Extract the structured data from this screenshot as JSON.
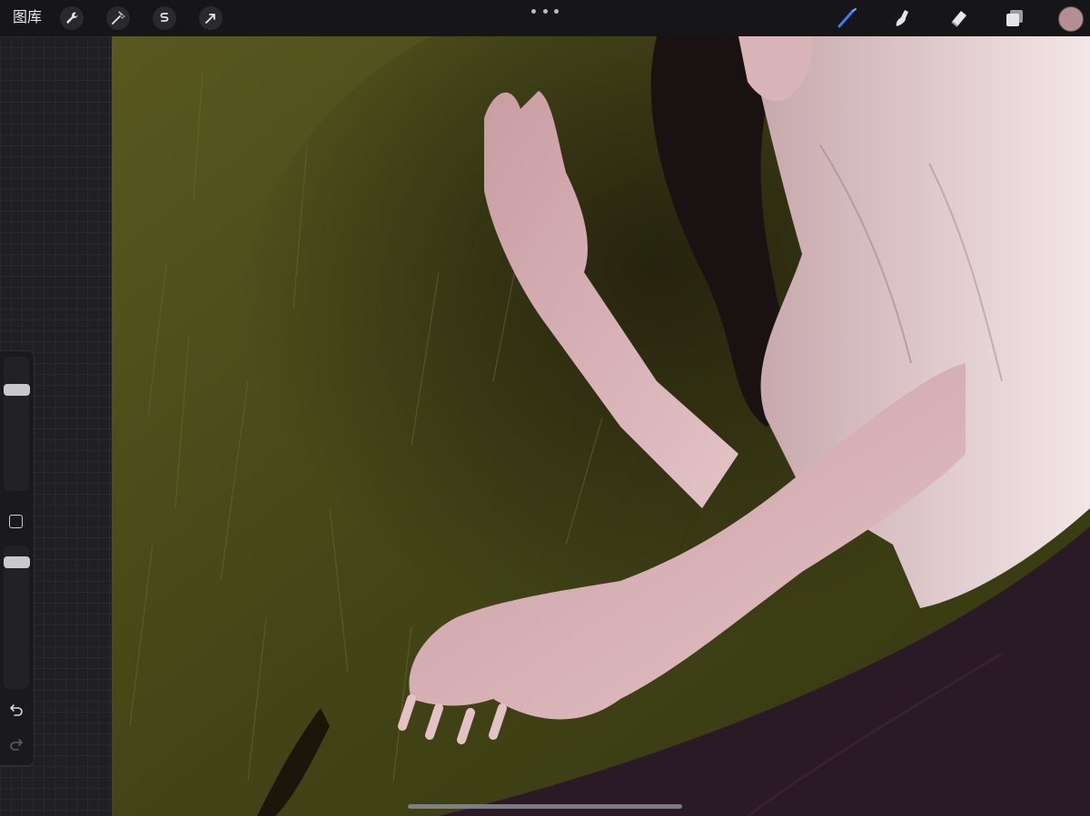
{
  "toolbar": {
    "gallery_label": "图库",
    "left_tools": [
      {
        "icon": "wrench-icon",
        "name": "actions"
      },
      {
        "icon": "magic-wand-icon",
        "name": "adjustments"
      },
      {
        "icon": "selection-s-icon",
        "name": "selection"
      },
      {
        "icon": "arrow-cursor-icon",
        "name": "transform"
      }
    ],
    "right_tools": [
      {
        "icon": "brush-icon",
        "name": "paint",
        "active": true
      },
      {
        "icon": "smudge-icon",
        "name": "smudge"
      },
      {
        "icon": "eraser-icon",
        "name": "eraser"
      },
      {
        "icon": "layers-icon",
        "name": "layers"
      }
    ],
    "current_color": "#b58e95",
    "active_tool_color": "#3a7bff"
  },
  "sidebar": {
    "brush_size_level": 0.78,
    "opacity_level": 0.92,
    "icons": [
      "modify-square-icon",
      "undo-icon",
      "redo-icon"
    ]
  },
  "canvas": {
    "palette": {
      "grass_dark": "#3f4318",
      "grass_mid": "#5a5a22",
      "shadow": "#2a2810",
      "skin": "#d9b4b8",
      "shirt": "#e8cfd1",
      "hair": "#1a1212",
      "skirt": "#2a1a26"
    }
  }
}
